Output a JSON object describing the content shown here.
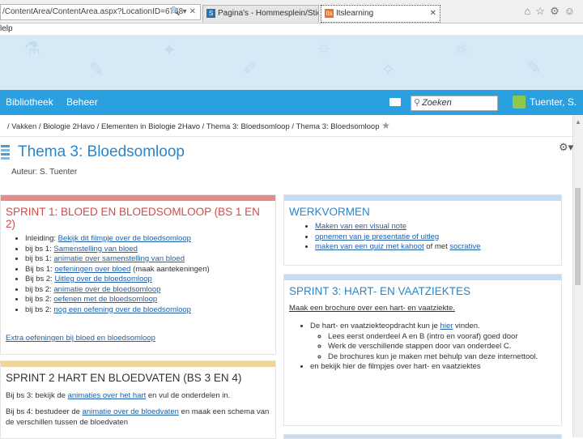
{
  "browser": {
    "address": "/ContentArea/ContentArea.aspx?LocationID=6768",
    "tabs": [
      {
        "label": "Pagina's - Hommesplein/Stichti..."
      },
      {
        "label": "Itslearning"
      }
    ],
    "menu_fragment": "lelp"
  },
  "nav": {
    "items": [
      "Bibliotheek",
      "Beheer"
    ],
    "search_placeholder": "Zoeken",
    "user": "Tuenter, S."
  },
  "breadcrumb": {
    "parts": [
      "Vakken",
      "Biologie 2Havo",
      "Elementen in Biologie 2Havo",
      "Thema 3: Bloedsomloop",
      "Thema 3: Bloedsomloop"
    ],
    "separator": "/"
  },
  "page": {
    "title": "Thema 3: Bloedsomloop",
    "author": "Auteur: S. Tuenter"
  },
  "sprint1": {
    "heading": "SPRINT 1: BLOED EN BLOEDSOMLOOP (BS 1 EN 2)",
    "items": [
      {
        "pre": "Inleiding: ",
        "link": "Bekijk dit filmpje over de bloedsomloop",
        "post": ""
      },
      {
        "pre": "bij bs 1: ",
        "link": "Samenstelling van bloed",
        "post": ""
      },
      {
        "pre": "bij bs 1: ",
        "link": "animatie over samenstelling van bloed",
        "post": ""
      },
      {
        "pre": "Bij bs 1: ",
        "link": "oefeningen over bloed",
        "post": " (maak aantekeningen)"
      },
      {
        "pre": "Bij bs 2: ",
        "link": "Uitleg over de bloedsomloop",
        "post": ""
      },
      {
        "pre": "bij bs 2: ",
        "link": "animatie over de bloedsomloop",
        "post": ""
      },
      {
        "pre": "bij bs 2: ",
        "link": "oefenen met de bloedsomloop",
        "post": ""
      },
      {
        "pre": "bij bs 2: ",
        "link": "nog een oefening over de bloedsomloop",
        "post": ""
      }
    ],
    "extra": "Extra oefeningen bij bloed en bloedsomloop"
  },
  "sprint2": {
    "heading": "SPRINT 2 HART EN BLOEDVATEN (BS 3 EN 4)",
    "line1": {
      "pre": "Bij bs 3: bekijk de ",
      "link": "animaties over het hart",
      "post": " en vul de onderdelen in."
    },
    "line2": {
      "pre": "Bij bs 4: bestudeer de ",
      "link": "animatie over de bloedvaten",
      "post": " en maak een schema van de verschillen tussen de bloedvaten"
    }
  },
  "werkvormen": {
    "heading": "WERKVORMEN",
    "items": [
      {
        "pre": "",
        "link": "Maken van een visual note",
        "post": ""
      },
      {
        "pre": "",
        "link": "opnemen van je presentatie of uitleg",
        "post": ""
      },
      {
        "pre": "",
        "link": "maken van een quiz met kahoot",
        "post": " of met ",
        "link2": "socrative"
      }
    ]
  },
  "sprint3": {
    "heading": "SPRINT 3: HART- EN VAATZIEKTES",
    "intro": "Maak een brochure over een hart- en vaatziekte.",
    "item1": {
      "pre": "De hart- en vaatziekteopdracht kun je ",
      "link": "hier",
      "post": " vinden."
    },
    "subitems": [
      "Lees eerst onderdeel A en B (intro en vooraf) goed door",
      "Werk de verschillende stappen door van onderdeel C.",
      "De brochures kun je maken met behulp van deze internettool."
    ],
    "item2": "en bekijk hier de filmpjes over hart- en vaatziektes"
  },
  "colors": {
    "nav": "#2aa0e0",
    "sprint1_bar": "#e58b8b",
    "sprint2_bar": "#f0d49a",
    "blue_bar": "#c4ddf2",
    "title": "#2a86c8"
  }
}
